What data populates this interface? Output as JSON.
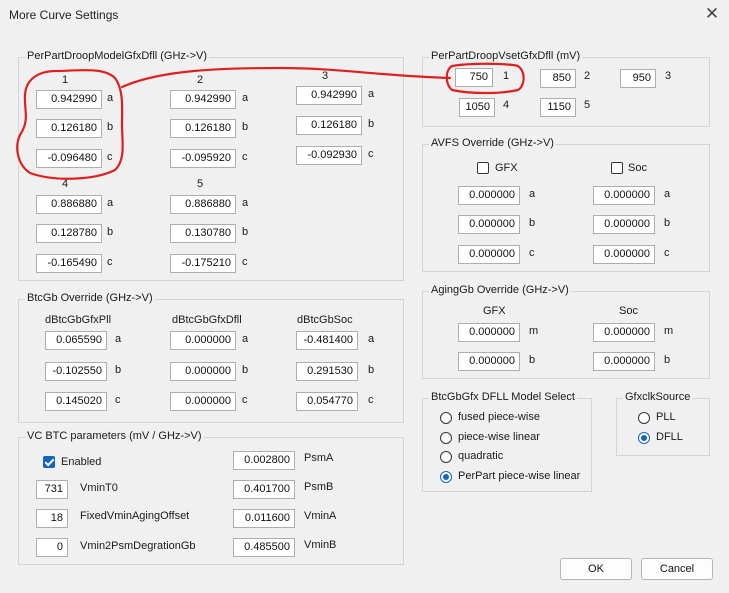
{
  "window": {
    "title": "More Curve Settings",
    "close_glyph": "✕"
  },
  "droop_model": {
    "legend": "PerPartDroopModelGfxDfll (GHz->V)",
    "columns": [
      {
        "index": "1",
        "a": "0.942990",
        "b": "0.126180",
        "c": "-0.096480"
      },
      {
        "index": "2",
        "a": "0.942990",
        "b": "0.126180",
        "c": "-0.095920"
      },
      {
        "index": "3",
        "a": "0.942990",
        "b": "0.126180",
        "c": "-0.092930"
      },
      {
        "index": "4",
        "a": "0.886880",
        "b": "0.128780",
        "c": "-0.165490"
      },
      {
        "index": "5",
        "a": "0.886880",
        "b": "0.130780",
        "c": "-0.175210"
      }
    ],
    "coef_labels": {
      "a": "a",
      "b": "b",
      "c": "c"
    }
  },
  "droop_vset": {
    "legend": "PerPartDroopVsetGfxDfll (mV)",
    "items": [
      {
        "value": "750",
        "index": "1"
      },
      {
        "value": "850",
        "index": "2"
      },
      {
        "value": "950",
        "index": "3"
      },
      {
        "value": "1050",
        "index": "4"
      },
      {
        "value": "1150",
        "index": "5"
      }
    ]
  },
  "avfs": {
    "legend": "AVFS Override (GHz->V)",
    "gfx_label": "GFX",
    "soc_label": "Soc",
    "gfx_checked": false,
    "soc_checked": false,
    "gfx": {
      "a": "0.000000",
      "b": "0.000000",
      "c": "0.000000"
    },
    "soc": {
      "a": "0.000000",
      "b": "0.000000",
      "c": "0.000000"
    }
  },
  "btcgb": {
    "legend": "BtcGb Override (GHz->V)",
    "headers": [
      "dBtcGbGfxPll",
      "dBtcGbGfxDfll",
      "dBtcGbSoc"
    ],
    "gfxpll": {
      "a": "0.065590",
      "b": "-0.102550",
      "c": "0.145020"
    },
    "gfxdfll": {
      "a": "0.000000",
      "b": "0.000000",
      "c": "0.000000"
    },
    "soc": {
      "a": "-0.481400",
      "b": "0.291530",
      "c": "0.054770"
    }
  },
  "aginggb": {
    "legend": "AgingGb Override (GHz->V)",
    "gfx_label": "GFX",
    "soc_label": "Soc",
    "m_label": "m",
    "b_label": "b",
    "gfx": {
      "m": "0.000000",
      "b": "0.000000"
    },
    "soc": {
      "m": "0.000000",
      "b": "0.000000"
    }
  },
  "vcbtc": {
    "legend": "VC BTC parameters (mV / GHz->V)",
    "enabled_label": "Enabled",
    "enabled": true,
    "left": [
      {
        "value": "731",
        "label": "VminT0"
      },
      {
        "value": "18",
        "label": "FixedVminAgingOffset"
      },
      {
        "value": "0",
        "label": "Vmin2PsmDegrationGb"
      }
    ],
    "right": [
      {
        "value": "0.002800",
        "label": "PsmA"
      },
      {
        "value": "0.401700",
        "label": "PsmB"
      },
      {
        "value": "0.011600",
        "label": "VminA"
      },
      {
        "value": "0.485500",
        "label": "VminB"
      }
    ]
  },
  "dfll_model": {
    "legend": "BtcGbGfx DFLL Model Select",
    "options": [
      "fused piece-wise",
      "piece-wise linear",
      "quadratic",
      "PerPart piece-wise linear"
    ],
    "selected": 3
  },
  "gfxclk": {
    "legend": "GfxclkSource",
    "options": [
      "PLL",
      "DFLL"
    ],
    "selected": 1
  },
  "buttons": {
    "ok": "OK",
    "cancel": "Cancel"
  },
  "colors": {
    "accent": "#1565c0",
    "annotation": "#e02020"
  }
}
